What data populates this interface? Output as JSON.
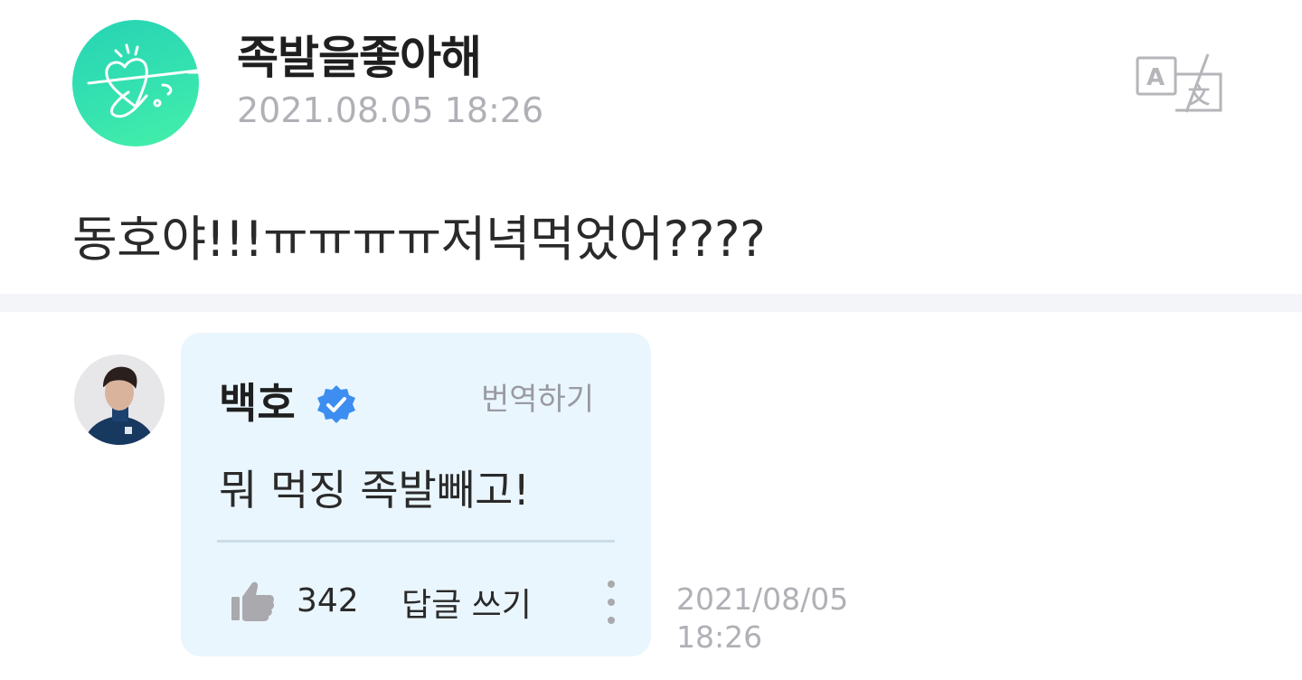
{
  "post": {
    "author": "족발을좋아해",
    "date": "2021.08.05 18:26",
    "body": "동호야!!!ㅠㅠㅠㅠ저녁먹었어????",
    "avatar_icon": "heart-doodle-avatar",
    "translate_icon": "translate-icon"
  },
  "comment": {
    "author": "백호",
    "verified_icon": "verified-badge-icon",
    "translate_label": "번역하기",
    "text": "뭐 먹징 족발빼고!",
    "like_icon": "thumbs-up-icon",
    "like_count": "342",
    "reply_label": "답글 쓰기",
    "more_icon": "more-vertical-icon",
    "date_line1": "2021/08/05",
    "date_line2": "18:26"
  },
  "colors": {
    "avatar_gradient_start": "#26d3b4",
    "avatar_gradient_end": "#45f0a8",
    "bubble_bg": "#eaf6fe",
    "verified_blue": "#3d8ef0",
    "muted_text": "#b0b0b6"
  }
}
